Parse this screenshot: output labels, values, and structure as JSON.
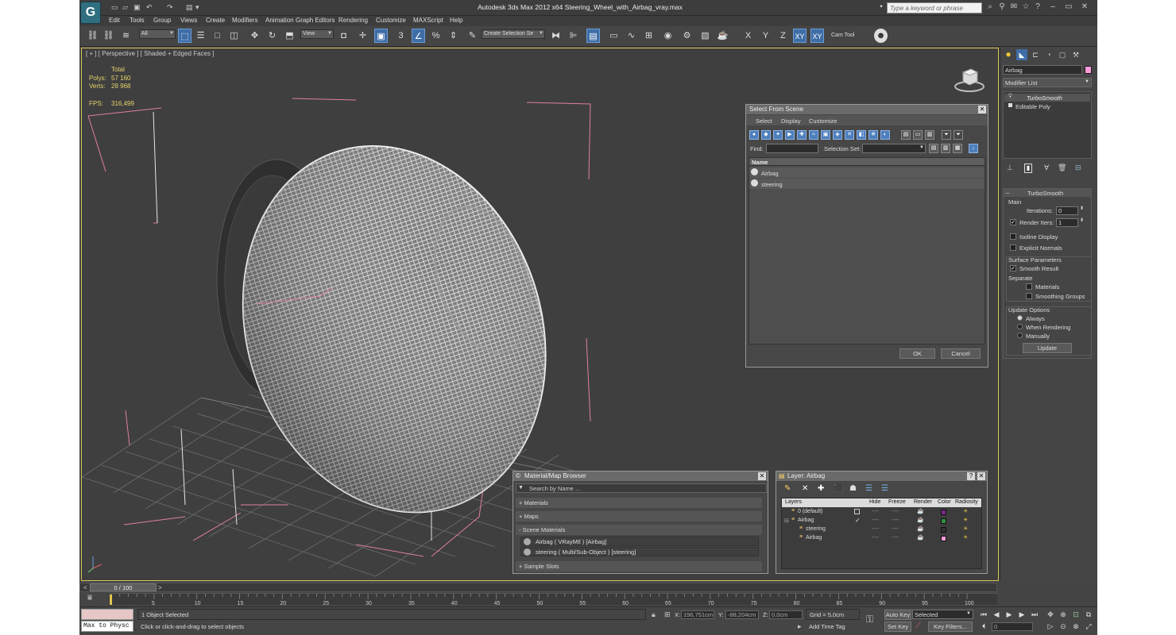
{
  "title_bar": {
    "window_title": "Autodesk 3ds Max  2012 x64      Steering_Wheel_with_Airbag_vray.max",
    "search_placeholder": "Type a keyword or phrase"
  },
  "menu": [
    "Edit",
    "Tools",
    "Group",
    "Views",
    "Create",
    "Modifiers",
    "Animation",
    "Graph Editors",
    "Rendering",
    "Customize",
    "MAXScript",
    "Help"
  ],
  "toolbar": {
    "filter_value": "All",
    "ref_coord_value": "View",
    "snap_number": "3",
    "named_selection_placeholder": "Create Selection Se",
    "axis_labels": [
      "X",
      "Y",
      "Z",
      "XY",
      "XY"
    ],
    "plugin_label": "Cam Tool"
  },
  "viewport": {
    "label": "[ + ] [ Perspective ] [ Shaded + Edged Faces ]",
    "stats": {
      "total_label": "Total",
      "polys_label": "Polys:",
      "polys_value": "57 160",
      "verts_label": "Verts:",
      "verts_value": "28 968",
      "fps_label": "FPS:",
      "fps_value": "316,499"
    }
  },
  "command_panel": {
    "object_name": "Airbag",
    "object_color": "#ff9ad8",
    "modifier_list_label": "Modifier List",
    "stack": [
      "TurboSmooth",
      "Editable Poly"
    ],
    "rollout_title": "TurboSmooth",
    "main_label": "Main",
    "iterations_label": "Iterations:",
    "iterations_value": "0",
    "render_iters_label": "Render Iters:",
    "render_iters_value": "1",
    "isoline_label": "Isoline Display",
    "explicit_normals_label": "Explicit Normals",
    "surface_params_label": "Surface Parameters",
    "smooth_result_label": "Smooth Result",
    "separate_label": "Separate",
    "materials_label": "Materials",
    "smoothing_groups_label": "Smoothing Groups",
    "update_options_label": "Update Options",
    "always_label": "Always",
    "when_rendering_label": "When Rendering",
    "manually_label": "Manually",
    "update_button": "Update"
  },
  "select_from_scene": {
    "title": "Select From Scene",
    "menus": [
      "Select",
      "Display",
      "Customize"
    ],
    "find_label": "Find:",
    "selection_set_label": "Selection Set:",
    "name_header": "Name",
    "items": [
      "Airbag",
      "steering"
    ],
    "ok": "OK",
    "cancel": "Cancel"
  },
  "material_browser": {
    "title": "Material/Map Browser",
    "search_placeholder": "Search by Name ...",
    "sections": [
      "+ Materials",
      "+ Maps",
      "- Scene Materials",
      "+ Sample Slots"
    ],
    "scene_materials": [
      "Airbag  ( VRayMtl ) [Airbag]",
      "steering  ( Multi/Sub-Object ) [steering]"
    ]
  },
  "layer_dialog": {
    "title": "Layer: Airbag",
    "headers": [
      "Layers",
      "Hide",
      "Freeze",
      "Render",
      "Color",
      "Radiosity"
    ],
    "rows": [
      {
        "name": "0 (default)",
        "hide": "----",
        "freeze": "----",
        "color": "#7a2a8a"
      },
      {
        "name": "Airbag",
        "hide": "----",
        "freeze": "----",
        "color": "#2f8f3a"
      },
      {
        "name": "steering",
        "hide": "----",
        "freeze": "----",
        "color": "#333333"
      },
      {
        "name": "Airbag",
        "hide": "----",
        "freeze": "----",
        "color": "#ff9ad8"
      }
    ]
  },
  "timeline": {
    "frame_label": "0 / 100",
    "ticks": [
      "0",
      "5",
      "10",
      "15",
      "20",
      "25",
      "30",
      "35",
      "40",
      "45",
      "50",
      "55",
      "60",
      "65",
      "70",
      "75",
      "80",
      "85",
      "90",
      "95",
      "100"
    ]
  },
  "status_bar": {
    "script_listener": "Max to Physc",
    "selection_status": "1 Object Selected",
    "prompt": "Click or click-and-drag to select objects",
    "x_label": "X:",
    "x_value": "196,751cm",
    "y_label": "Y:",
    "y_value": "-88,204cm",
    "z_label": "Z:",
    "z_value": "0,0cm",
    "grid": "Grid = 5,0cm",
    "add_time_tag": "Add Time Tag",
    "auto_key": "Auto Key",
    "set_key": "Set Key",
    "selected_value": "Selected",
    "key_filters": "Key Filters...",
    "frame_value": "0"
  }
}
